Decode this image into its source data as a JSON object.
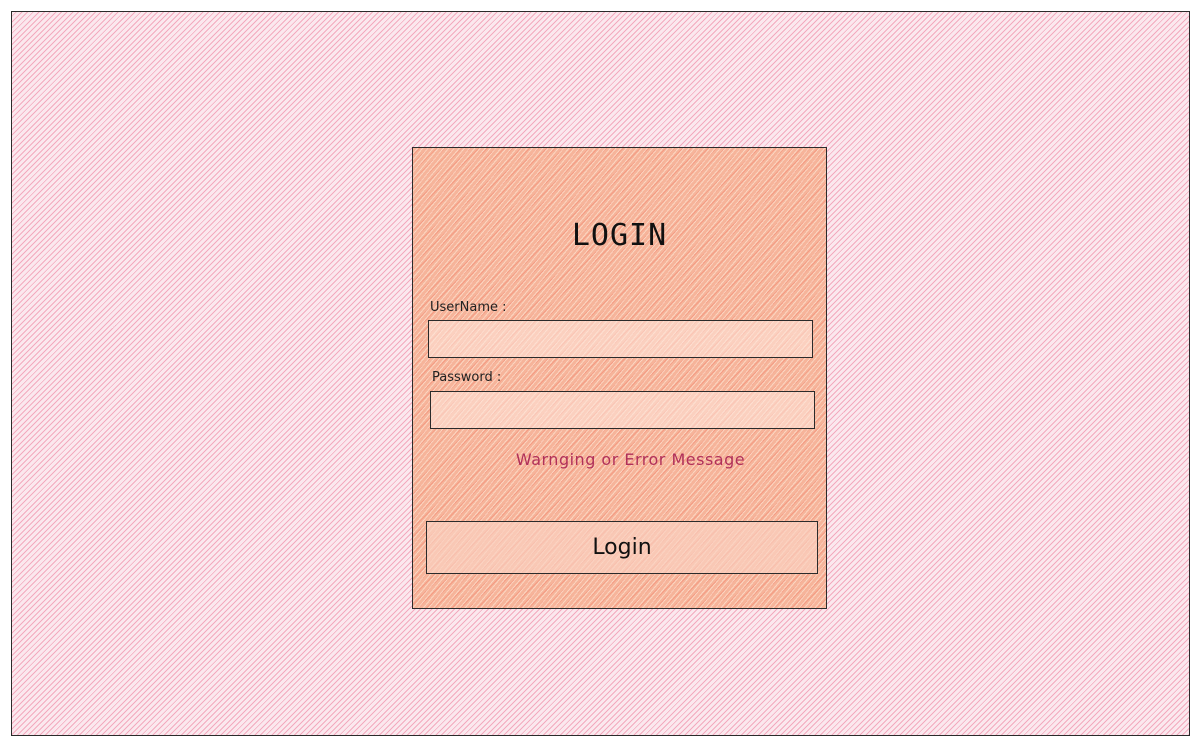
{
  "login_card": {
    "title": "LOGIN",
    "username_label": "UserName :",
    "username_value": "",
    "password_label": "Password :",
    "password_value": "",
    "message": "Warnging or Error Message",
    "submit_label": "Login"
  },
  "colors": {
    "background_hatch": "#f4a6bc",
    "card_fill": "#f6b49a",
    "message_text": "#b0305a",
    "outline": "#2b2b2b"
  }
}
